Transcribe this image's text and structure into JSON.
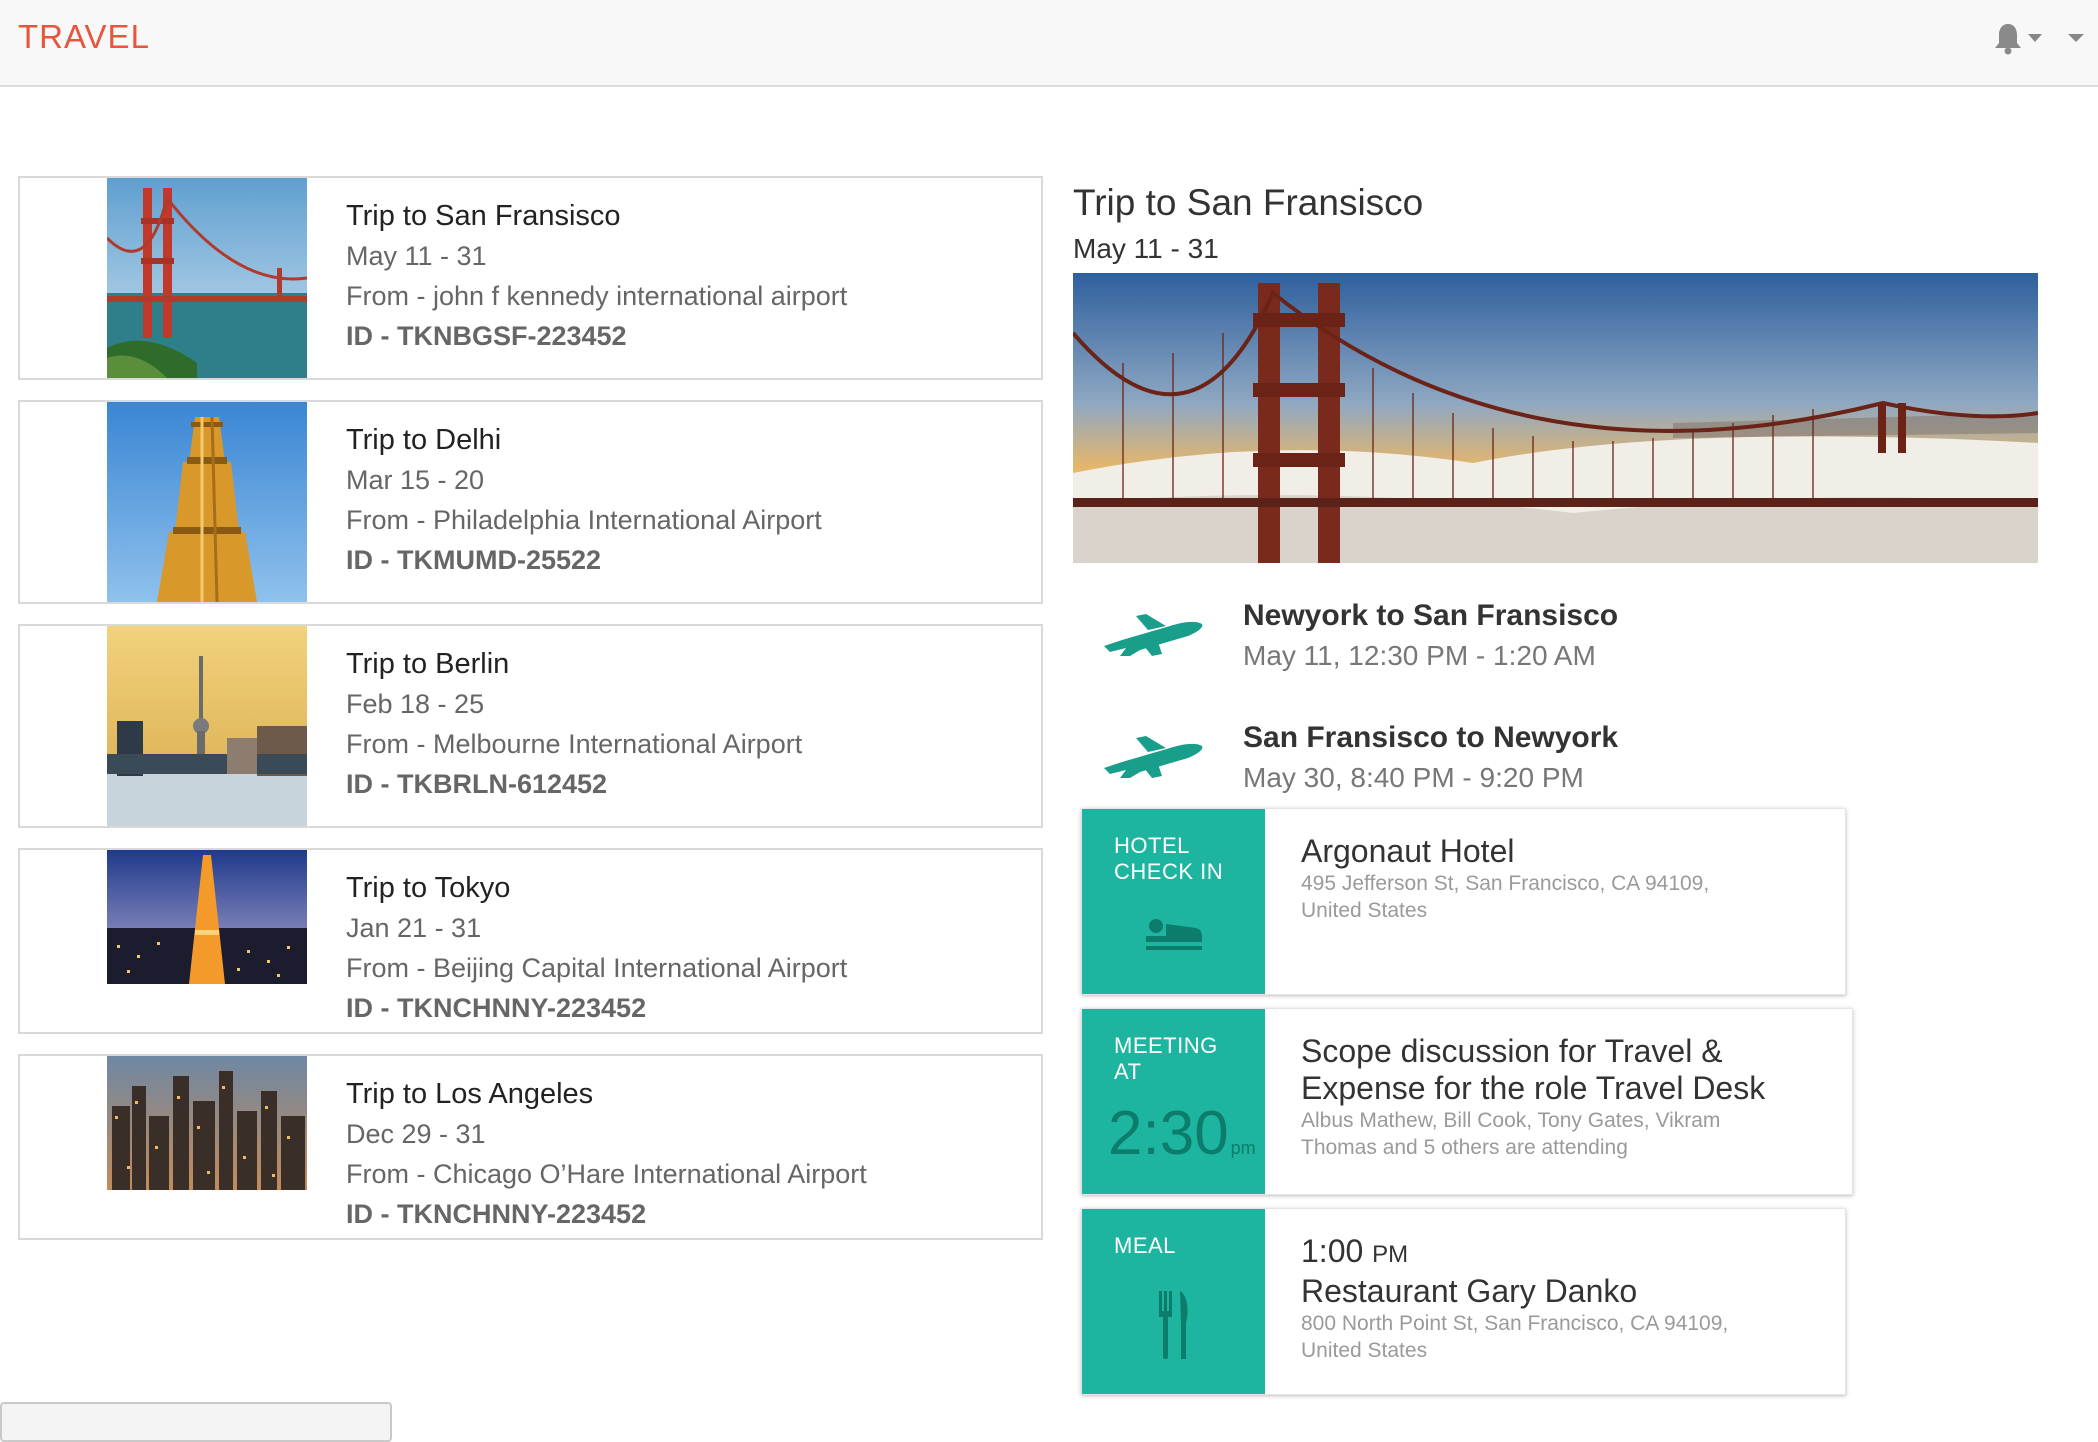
{
  "app": {
    "brand": "TRAVEL"
  },
  "colors": {
    "brand": "#e8553e",
    "teal": "#1eb5a0",
    "teal_dark": "#0c7c6d"
  },
  "header": {
    "icons": [
      "bell-icon",
      "chevron-down-icon",
      "chevron-down-icon"
    ]
  },
  "trips": [
    {
      "title": "Trip to San Fransisco",
      "dates": "May 11 - 31",
      "from": "From - john f kennedy international airport",
      "id": "ID - TKNBGSF-223452",
      "thumb": "golden-gate-bridge"
    },
    {
      "title": "Trip to Delhi",
      "dates": "Mar 15 - 20",
      "from": "From - Philadelphia International Airport",
      "id": "ID - TKMUMD-25522",
      "thumb": "qutub-minar"
    },
    {
      "title": "Trip to Berlin",
      "dates": "Feb 18 - 25",
      "from": "From - Melbourne International Airport",
      "id": "ID - TKBRLN-612452",
      "thumb": "berlin-tv-tower"
    },
    {
      "title": "Trip to Tokyo",
      "dates": "Jan 21 - 31",
      "from": "From - Beijing Capital International Airport",
      "id": "ID - TKNCHNNY-223452",
      "thumb": "tokyo-tower"
    },
    {
      "title": "Trip to Los Angeles",
      "dates": "Dec 29 - 31",
      "from": "From - Chicago O’Hare International Airport",
      "id": "ID - TKNCHNNY-223452",
      "thumb": "city-skyline"
    }
  ],
  "detail": {
    "title": "Trip to San Fransisco",
    "dates": "May 11 - 31",
    "flights": [
      {
        "route": "Newyork to San Fransisco",
        "time": "May 11, 12:30 PM - 1:20 AM",
        "icon": "airplane-icon"
      },
      {
        "route": "San Fransisco to Newyork",
        "time": "May 30, 8:40 PM - 9:20 PM",
        "icon": "airplane-icon"
      }
    ],
    "hotel": {
      "kind_line1": "HOTEL",
      "kind_line2": "CHECK IN",
      "icon": "bed-icon",
      "name": "Argonaut Hotel",
      "address_line1": "495 Jefferson St, San Francisco, CA 94109,",
      "address_line2": "United States"
    },
    "meeting": {
      "kind_line1": "MEETING",
      "kind_line2": "AT",
      "time": "2:30",
      "ampm": "pm",
      "title_line1": "Scope discussion for Travel &",
      "title_line2": "Expense for the role Travel Desk",
      "attendees_line1": "Albus Mathew, Bill Cook, Tony Gates, Vikram",
      "attendees_line2": "Thomas and 5 others are attending"
    },
    "meal": {
      "kind": "MEAL",
      "icon": "fork-knife-icon",
      "time": "1:00",
      "ampm": "PM",
      "name": "Restaurant Gary Danko",
      "address_line1": "800 North Point St, San Francisco, CA 94109,",
      "address_line2": "United States"
    }
  }
}
